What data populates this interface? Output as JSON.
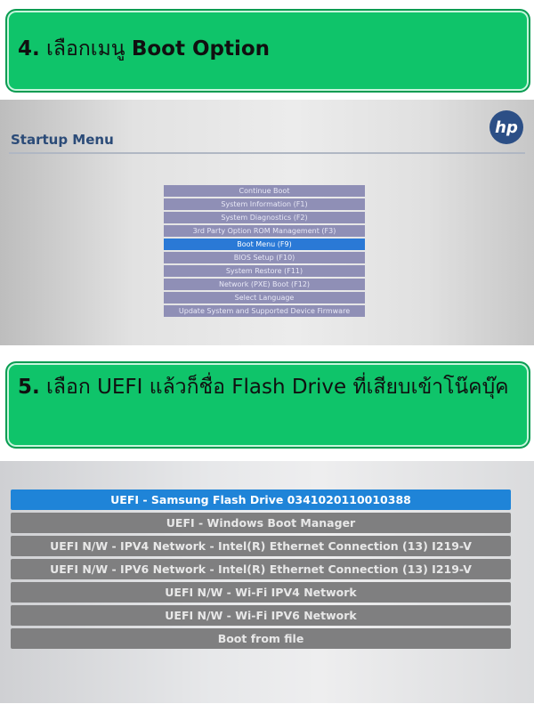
{
  "step4": {
    "number": "4.",
    "text": " เลือกเมนู ",
    "highlight": "Boot Option"
  },
  "startup_menu": {
    "title": "Startup Menu",
    "logo": "hp",
    "items": [
      {
        "label": "Continue Boot",
        "selected": false
      },
      {
        "label": "System Information (F1)",
        "selected": false
      },
      {
        "label": "System Diagnostics (F2)",
        "selected": false
      },
      {
        "label": "3rd Party Option ROM Management (F3)",
        "selected": false
      },
      {
        "label": "Boot Menu (F9)",
        "selected": true
      },
      {
        "label": "BIOS Setup (F10)",
        "selected": false
      },
      {
        "label": "System Restore (F11)",
        "selected": false
      },
      {
        "label": "Network (PXE) Boot (F12)",
        "selected": false
      },
      {
        "label": "Select Language",
        "selected": false
      },
      {
        "label": "Update System and Supported Device Firmware",
        "selected": false
      }
    ]
  },
  "step5": {
    "number": "5.",
    "text": " เลือก UEFI แล้วก็ชื่อ Flash Drive ที่เสียบเข้าโน๊คบุ๊ค"
  },
  "boot_menu": {
    "items": [
      {
        "label": "UEFI - Samsung Flash Drive 0341020110010388",
        "selected": true
      },
      {
        "label": "UEFI - Windows Boot Manager",
        "selected": false
      },
      {
        "label": "UEFI N/W - IPV4 Network - Intel(R) Ethernet Connection (13) I219-V",
        "selected": false
      },
      {
        "label": "UEFI N/W - IPV6 Network - Intel(R) Ethernet Connection (13) I219-V",
        "selected": false
      },
      {
        "label": "UEFI N/W - Wi-Fi IPV4 Network",
        "selected": false
      },
      {
        "label": "UEFI N/W - Wi-Fi IPV6 Network",
        "selected": false
      },
      {
        "label": "Boot from file",
        "selected": false
      }
    ]
  },
  "colors": {
    "banner_green": "#0fc46a",
    "selected_blue": "#2a79d6",
    "menu_purple": "#8f8fb6",
    "boot_gray": "#7f7f80"
  }
}
